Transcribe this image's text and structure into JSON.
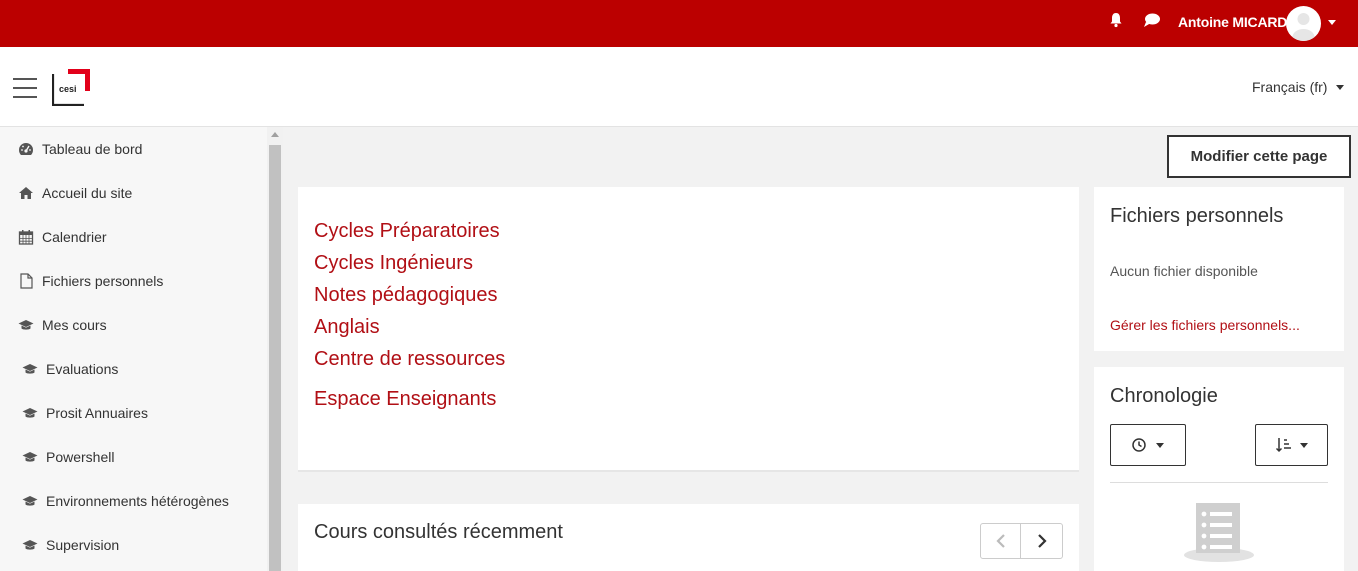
{
  "header": {
    "username": "Antoine MICARD",
    "icons": [
      "bell-icon",
      "chat-icon",
      "avatar",
      "chevron-down-icon"
    ],
    "brand_color": "#bb0000"
  },
  "navbar": {
    "logo_text": "cesi",
    "language": "Français (fr)"
  },
  "sidebar": {
    "items": [
      {
        "label": "Tableau de bord",
        "icon": "dashboard-icon"
      },
      {
        "label": "Accueil du site",
        "icon": "home-icon"
      },
      {
        "label": "Calendrier",
        "icon": "calendar-icon"
      },
      {
        "label": "Fichiers personnels",
        "icon": "file-icon"
      },
      {
        "label": "Mes cours",
        "icon": "graduation-cap-icon"
      },
      {
        "label": "Evaluations",
        "icon": "graduation-cap-icon"
      },
      {
        "label": "Prosit Annuaires",
        "icon": "graduation-cap-icon"
      },
      {
        "label": "Powershell",
        "icon": "graduation-cap-icon"
      },
      {
        "label": "Environnements hétérogènes",
        "icon": "graduation-cap-icon"
      },
      {
        "label": "Supervision",
        "icon": "graduation-cap-icon"
      }
    ]
  },
  "main": {
    "edit_button": "Modifier cette page",
    "categories": [
      "Cycles Préparatoires",
      "Cycles Ingénieurs",
      "Notes pédagogiques",
      "Anglais",
      "Centre de ressources",
      "Espace Enseignants"
    ],
    "recent_title": "Cours consultés récemment",
    "link_color": "#b10f15"
  },
  "files_block": {
    "title": "Fichiers personnels",
    "empty_text": "Aucun fichier disponible",
    "manage_link": "Gérer les fichiers personnels..."
  },
  "timeline_block": {
    "title": "Chronologie"
  }
}
